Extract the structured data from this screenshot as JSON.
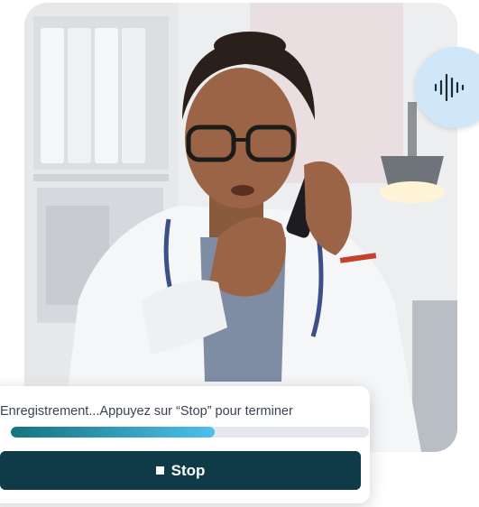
{
  "image": {
    "subject": "doctor-on-phone-photo"
  },
  "voice_button": {
    "icon": "audio-waveform-icon",
    "bg_color": "#cfe7f8"
  },
  "recording": {
    "status_text": "Enregistrement...Appuyez sur “Stop” pour terminer",
    "progress_fraction": 0.57,
    "stop_label": "Stop",
    "stop_icon": "stop-square-icon",
    "colors": {
      "button_bg": "#0f3b49",
      "progress_start": "#14737e",
      "progress_end": "#4ec0ee"
    }
  }
}
